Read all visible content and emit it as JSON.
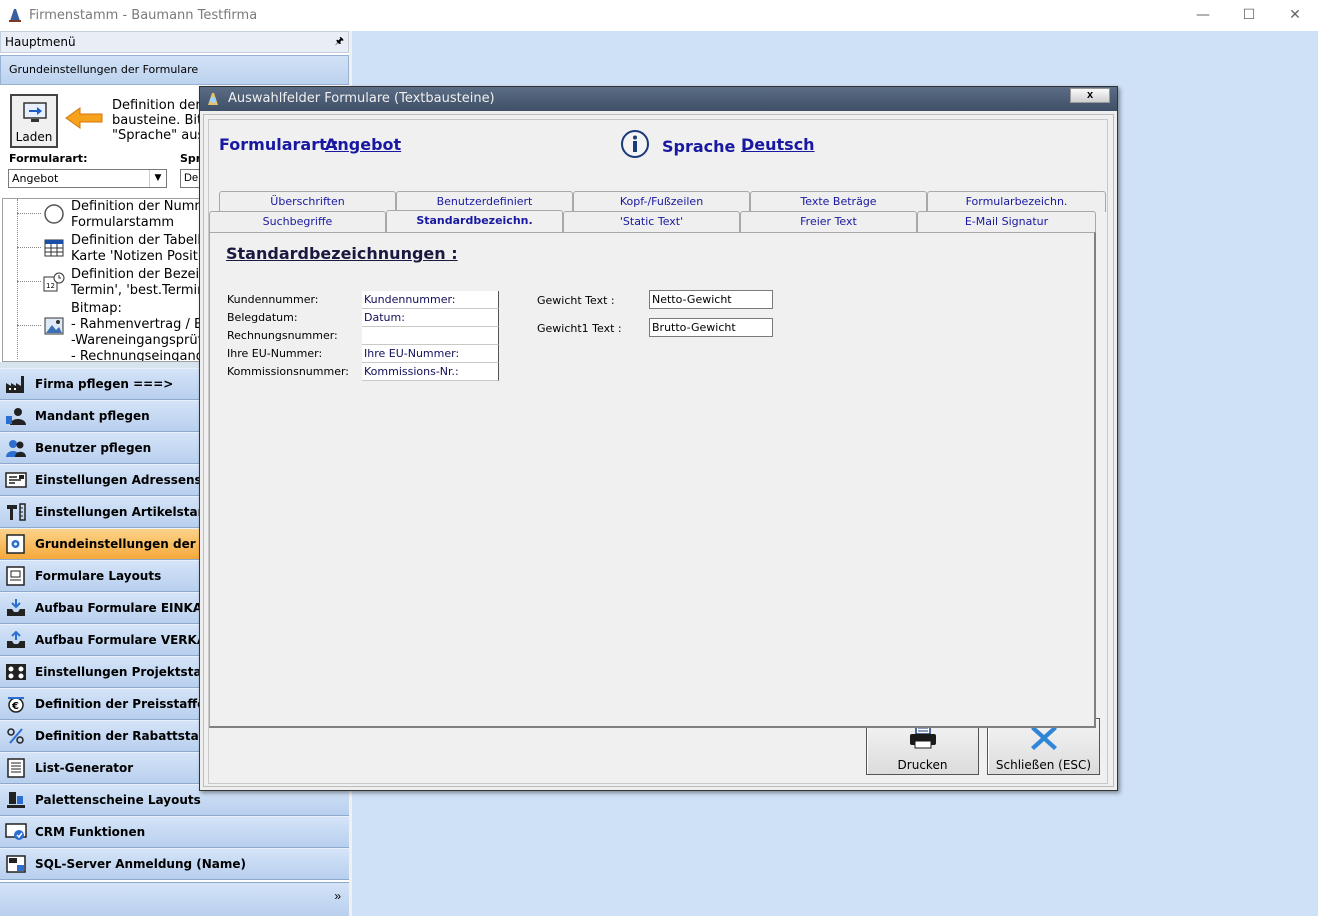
{
  "window": {
    "title": "Firmenstamm - Baumann Testfirma",
    "minimize": "—",
    "maximize": "☐",
    "close": "✕"
  },
  "sidebar": {
    "header": "Hauptmenü",
    "pin": "🖈",
    "subheader": "Grundeinstellungen der Formulare",
    "load_button": "Laden",
    "description": [
      "Definition der S",
      "bausteine. Bitte",
      "\"Sprache\" aus"
    ],
    "formularart_label": "Formularart:",
    "formularart_value": "Angebot",
    "sprache_label": "Spr",
    "sprache_value": "De",
    "tree": [
      {
        "icon": "circle-icon",
        "lines": [
          "Definition der Numme",
          "Formularstamm"
        ]
      },
      {
        "icon": "table-icon",
        "lines": [
          "Definition der Tabelle",
          "Karte 'Notizen Position"
        ]
      },
      {
        "icon": "calendar-clock-icon",
        "lines": [
          "Definition der Bezeich",
          "Termin', 'best.Termin'"
        ]
      },
      {
        "icon": "picture-icon",
        "lines": [
          "Bitmap:",
          "- Rahmenvertrag / Be",
          "-Wareneingangsprüfu",
          "- Rechnungseingangs"
        ]
      }
    ],
    "menu": [
      {
        "label": "Firma pflegen   ===>",
        "icon": "factory-icon",
        "active": false
      },
      {
        "label": "Mandant pflegen",
        "icon": "user-icon",
        "active": false
      },
      {
        "label": "Benutzer pflegen",
        "icon": "users-icon",
        "active": false
      },
      {
        "label": "Einstellungen Adressenstamm",
        "icon": "address-card-icon",
        "active": false
      },
      {
        "label": "Einstellungen Artikelstamm",
        "icon": "tools-icon",
        "active": false
      },
      {
        "label": "Grundeinstellungen der Formulare",
        "icon": "form-gear-icon",
        "active": true
      },
      {
        "label": "Formulare Layouts",
        "icon": "layout-icon",
        "active": false
      },
      {
        "label": "Aufbau Formulare EINKAUF",
        "icon": "inbox-down-icon",
        "active": false
      },
      {
        "label": "Aufbau Formulare VERKAUF",
        "icon": "inbox-up-icon",
        "active": false
      },
      {
        "label": "Einstellungen Projektstamm",
        "icon": "project-icon",
        "active": false
      },
      {
        "label": "Definition der Preisstaffel(n)",
        "icon": "price-scale-icon",
        "active": false
      },
      {
        "label": "Definition der Rabattstaffel(n)",
        "icon": "percent-icon",
        "active": false
      },
      {
        "label": "List-Generator",
        "icon": "list-icon",
        "active": false
      },
      {
        "label": "Palettenscheine Layouts",
        "icon": "pallet-icon",
        "active": false
      },
      {
        "label": "CRM Funktionen",
        "icon": "crm-icon",
        "active": false
      },
      {
        "label": "SQL-Server Anmeldung (Name)",
        "icon": "server-icon",
        "active": false
      }
    ],
    "footer_chevron": "»"
  },
  "dialog": {
    "title": "Auswahlfelder Formulare (Textbausteine)",
    "close": "x",
    "formularart_label": "Formularart :",
    "formularart_value": "Angebot",
    "sprache_label": "Sprache :",
    "sprache_value": "Deutsch",
    "tabs_row1": [
      "Überschriften",
      "Benutzerdefiniert",
      "Kopf-/Fußzeilen",
      "Texte Beträge",
      "Formularbezeichn."
    ],
    "tabs_row2": [
      "Suchbegriffe",
      "Standardbezeichn.",
      "'Static Text'",
      "Freier Text",
      "E-Mail Signatur"
    ],
    "active_tab": "Standardbezeichn.",
    "section_title": "Standardbezeichnungen :",
    "grid": [
      {
        "label": "Kundennummer:",
        "value": "Kundennummer:"
      },
      {
        "label": "Belegdatum:",
        "value": "Datum:"
      },
      {
        "label": "Rechnungsnummer:",
        "value": ""
      },
      {
        "label": "Ihre EU-Nummer:",
        "value": "Ihre EU-Nummer:"
      },
      {
        "label": "Kommissionsnummer:",
        "value": "Kommissions-Nr.:"
      }
    ],
    "gewicht_label": "Gewicht Text :",
    "gewicht_value": "Netto-Gewicht",
    "gewicht1_label": "Gewicht1 Text :",
    "gewicht1_value": "Brutto-Gewicht",
    "print_button": "Drucken",
    "close_button": "Schließen (ESC)"
  }
}
